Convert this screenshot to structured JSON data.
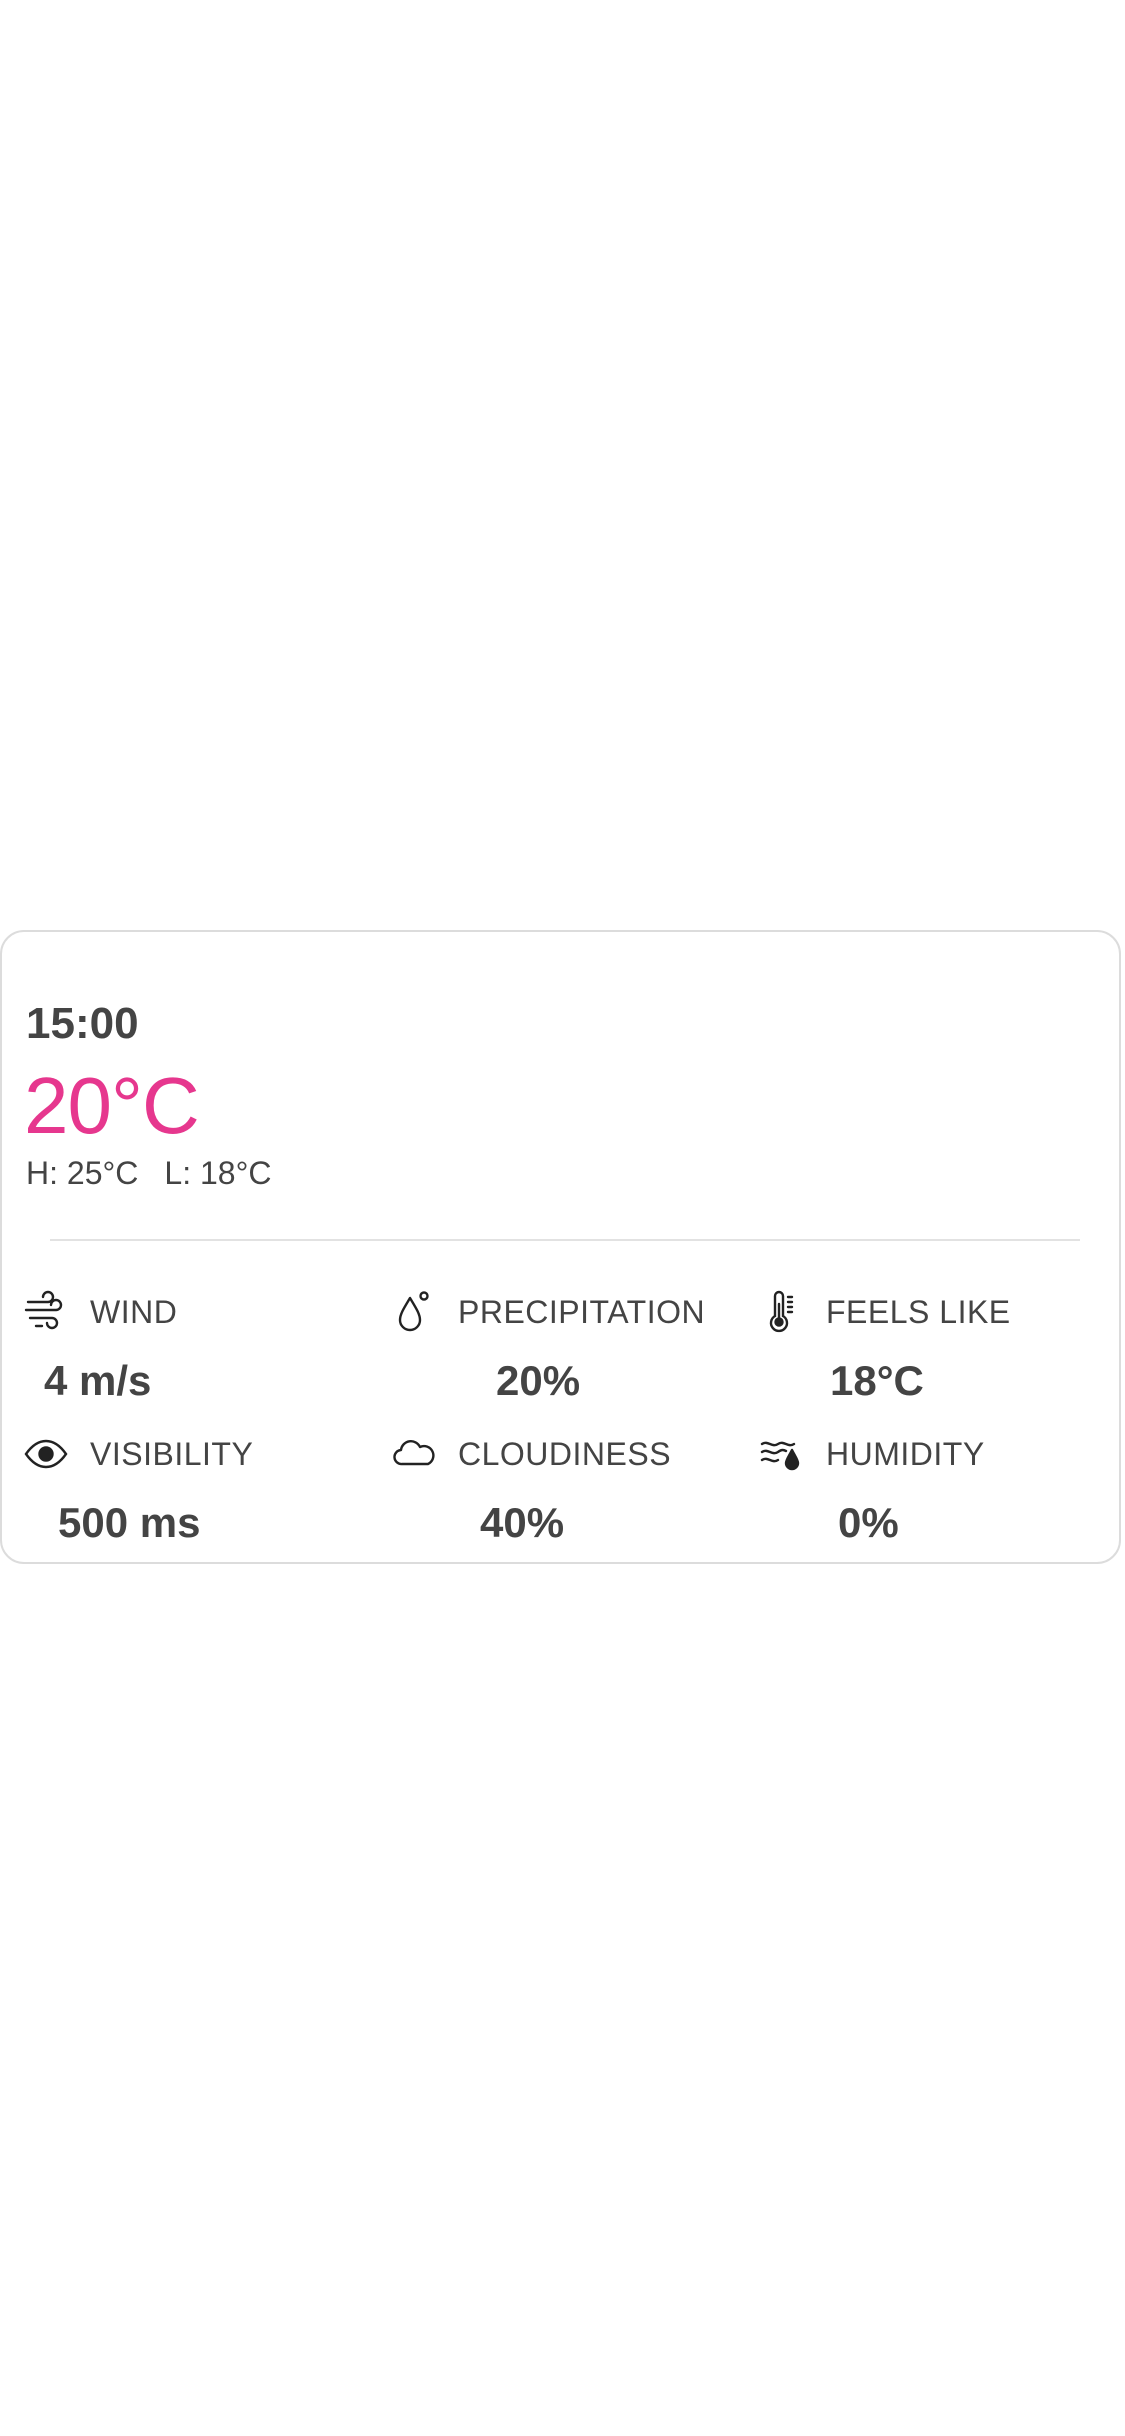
{
  "forecast": {
    "time": "15:00",
    "temperature": "20°C",
    "high": "H: 25°C",
    "low": "L: 18°C"
  },
  "colors": {
    "accent": "#e6378e",
    "text": "#444444",
    "border": "#dcdcdc"
  },
  "stats": [
    {
      "label": "WIND",
      "value": "4 m/s",
      "icon": "wind-icon"
    },
    {
      "label": "PRECIPITATION",
      "value": "20%",
      "icon": "droplet-icon"
    },
    {
      "label": "FEELS LIKE",
      "value": "18°C",
      "icon": "thermometer-icon"
    },
    {
      "label": "VISIBILITY",
      "value": "500 ms",
      "icon": "eye-icon"
    },
    {
      "label": "CLOUDINESS",
      "value": "40%",
      "icon": "cloud-icon"
    },
    {
      "label": "HUMIDITY",
      "value": "0%",
      "icon": "humidity-icon"
    }
  ]
}
